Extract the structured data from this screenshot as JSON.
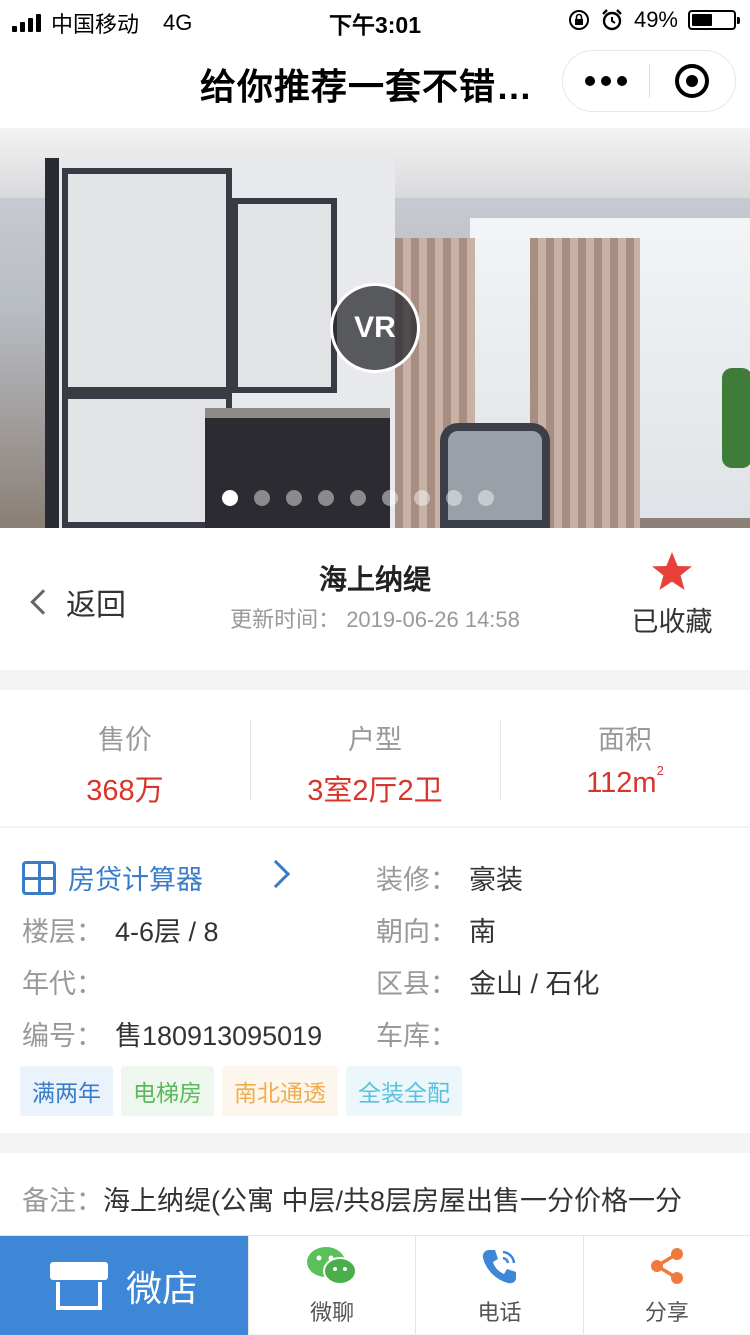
{
  "status_bar": {
    "carrier": "中国移动",
    "network": "4G",
    "time": "下午3:01",
    "battery_text": "49%",
    "battery_level": 0.49
  },
  "nav": {
    "title": "给你推荐一套不错…"
  },
  "gallery": {
    "vr_label": "VR",
    "total_slides": 9,
    "active_slide": 1
  },
  "header": {
    "back_label": "返回",
    "property_name": "海上纳缇",
    "update_time": "更新时间：  2019-06-26 14:58",
    "favorite_label": "已收藏",
    "favorite_color": "#e8413a"
  },
  "stats": [
    {
      "label": "售价",
      "value": "368万"
    },
    {
      "label": "户型",
      "value": "3室2厅2卫"
    },
    {
      "label": "面积",
      "value": "112m",
      "sup": "2"
    }
  ],
  "details": {
    "calculator_label": "房贷计算器",
    "decoration": {
      "label": "装修：",
      "value": "豪装"
    },
    "floor": {
      "label": "楼层：",
      "value": "4-6层 / 8"
    },
    "orientation": {
      "label": "朝向：",
      "value": "南"
    },
    "year": {
      "label": "年代：",
      "value": ""
    },
    "district": {
      "label": "区县：",
      "value": "金山 / 石化"
    },
    "number": {
      "label": "编号：",
      "value": "售180913095019"
    },
    "garage": {
      "label": "车库：",
      "value": ""
    }
  },
  "tags": [
    {
      "text": "满两年",
      "color": "#3a7cc7",
      "bg": "#eaf2fb"
    },
    {
      "text": "电梯房",
      "color": "#5cb85c",
      "bg": "#eef7ee"
    },
    {
      "text": "南北通透",
      "color": "#f0ad4e",
      "bg": "#fdf6ec"
    },
    {
      "text": "全装全配",
      "color": "#5bc0de",
      "bg": "#ebf7fb"
    }
  ],
  "remark": {
    "label": "备注：",
    "text": "海上纳缇(公寓 中层/共8层房屋出售一分价格一分"
  },
  "bottom_bar": {
    "shop_label": "微店",
    "chat_label": "微聊",
    "phone_label": "电话",
    "share_label": "分享",
    "accent": "#3e86d6"
  }
}
